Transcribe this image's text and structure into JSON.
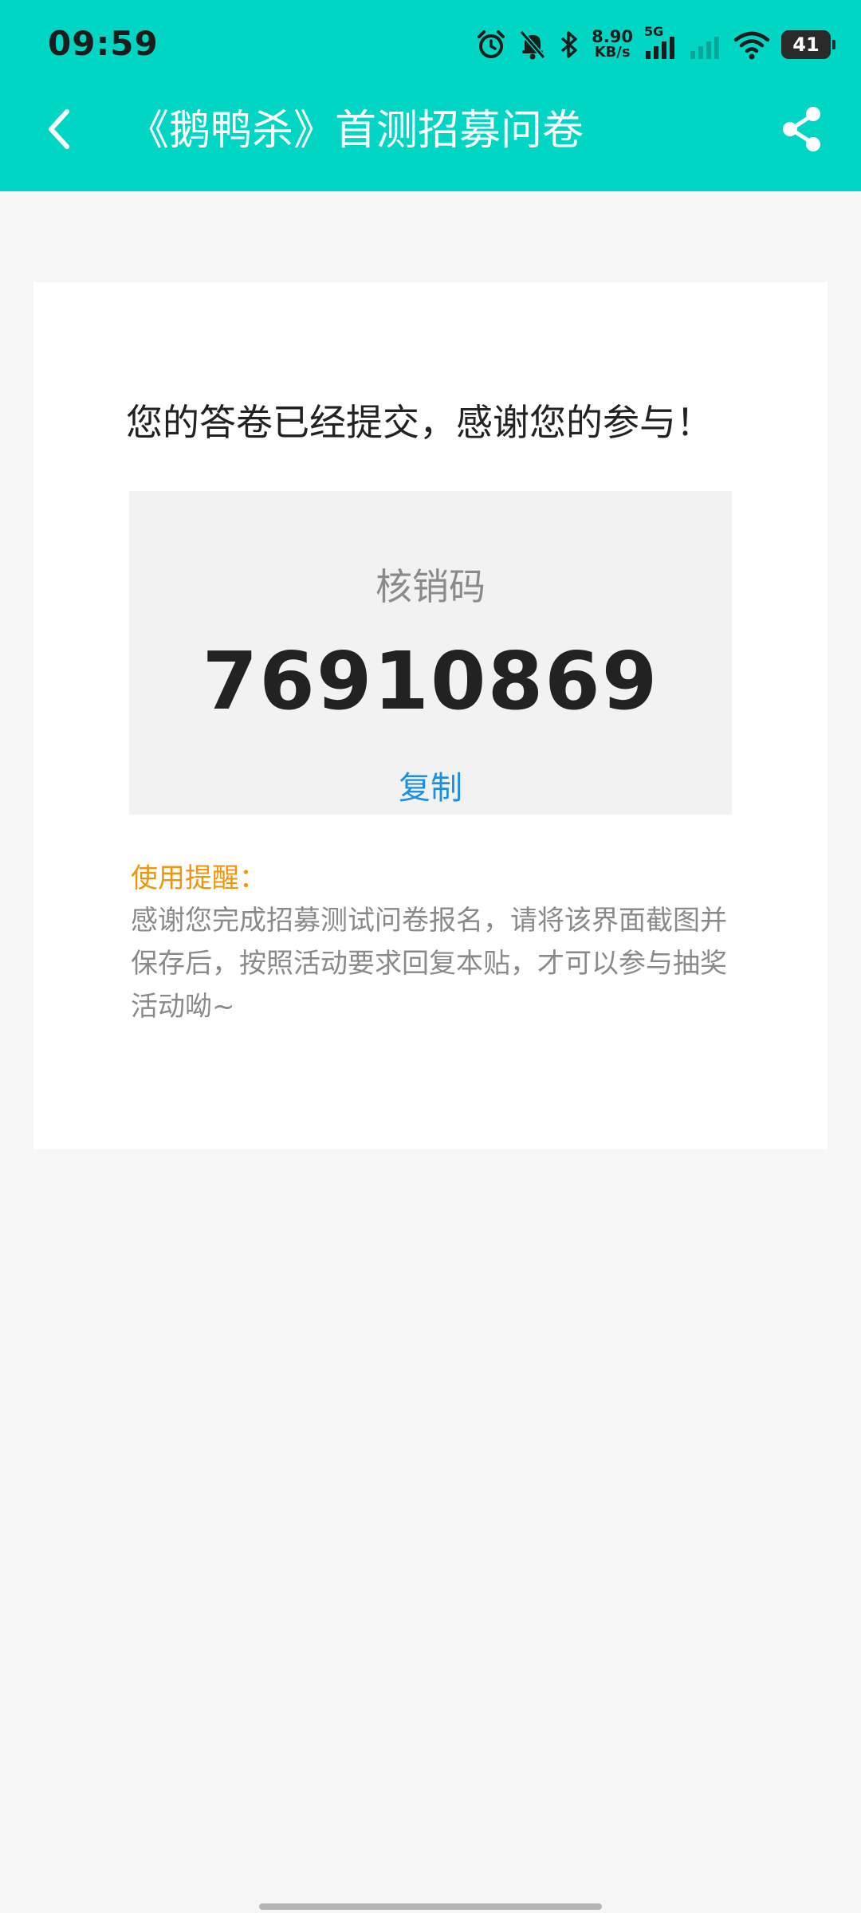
{
  "status_bar": {
    "time": "09:59",
    "net_speed_value": "8.90",
    "net_speed_unit": "KB/s",
    "network_type": "5G",
    "battery": "41",
    "icons": [
      "alarm-icon",
      "mute-bell-icon",
      "bluetooth-icon",
      "signal-icon",
      "signal-weak-icon",
      "wifi-icon",
      "battery-icon"
    ]
  },
  "nav": {
    "title": "《鹅鸭杀》首测招募问卷",
    "back_icon": "chevron-left-icon",
    "share_icon": "share-icon"
  },
  "card": {
    "message": "您的答卷已经提交，感谢您的参与！",
    "code_label": "核销码",
    "code_value": "76910869",
    "copy_label": "复制",
    "reminder_title": "使用提醒：",
    "reminder_text": "感谢您完成招募测试问卷报名，请将该界面截图并保存后，按照活动要求回复本贴，才可以参与抽奖活动呦~"
  },
  "colors": {
    "accent": "#00d6c3",
    "copy_link": "#1e8ee0",
    "reminder_title": "#f0940a"
  }
}
